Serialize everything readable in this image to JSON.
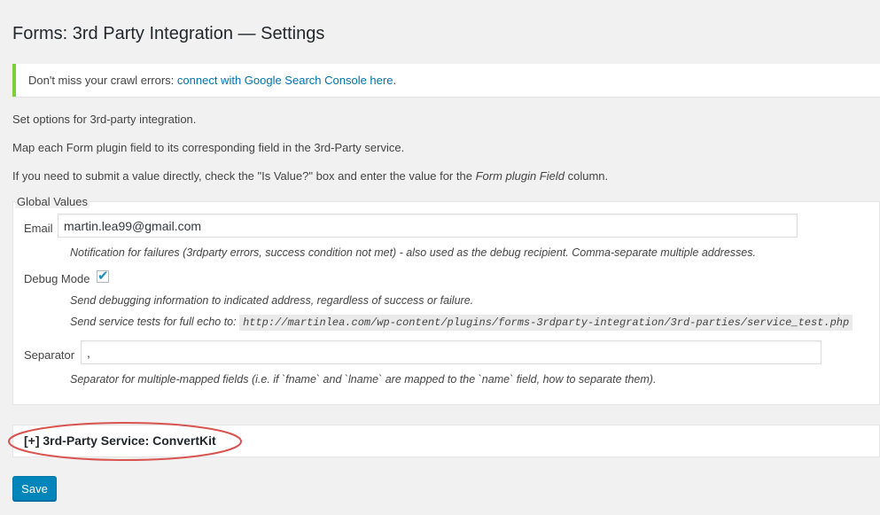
{
  "page": {
    "title": "Forms: 3rd Party Integration — Settings"
  },
  "notice": {
    "text": "Don't miss your crawl errors: ",
    "link_text": "connect with Google Search Console here",
    "trailing": "."
  },
  "intro": {
    "line1": "Set options for 3rd-party integration.",
    "line2": "Map each Form plugin field to its corresponding field in the 3rd-Party service.",
    "line3_a": "If you need to submit a value directly, check the \"Is Value?\" box and enter the value for the ",
    "line3_em": "Form plugin Field",
    "line3_b": " column."
  },
  "global_values": {
    "legend": "Global Values",
    "email": {
      "label": "Email",
      "value": "martin.lea99@gmail.com",
      "description": "Notification for failures (3rdparty errors, success condition not met) - also used as the debug recipient. Comma-separate multiple addresses."
    },
    "debug_mode": {
      "label": "Debug Mode",
      "checked": true,
      "desc1": "Send debugging information to indicated address, regardless of success or failure.",
      "desc2": "Send service tests for full echo to: ",
      "test_url": "http://martinlea.com/wp-content/plugins/forms-3rdparty-integration/3rd-parties/service_test.php"
    },
    "separator": {
      "label": "Separator",
      "value": ",",
      "description": "Separator for multiple-mapped fields (i.e. if `fname` and `lname` are mapped to the `name` field, how to separate them)."
    }
  },
  "service": {
    "label": "[+] 3rd-Party Service: ConvertKit"
  },
  "actions": {
    "save_label": "Save"
  },
  "colors": {
    "accent": "#0085ba",
    "notice_border": "#7ad03a",
    "annotation": "#d9534f"
  }
}
